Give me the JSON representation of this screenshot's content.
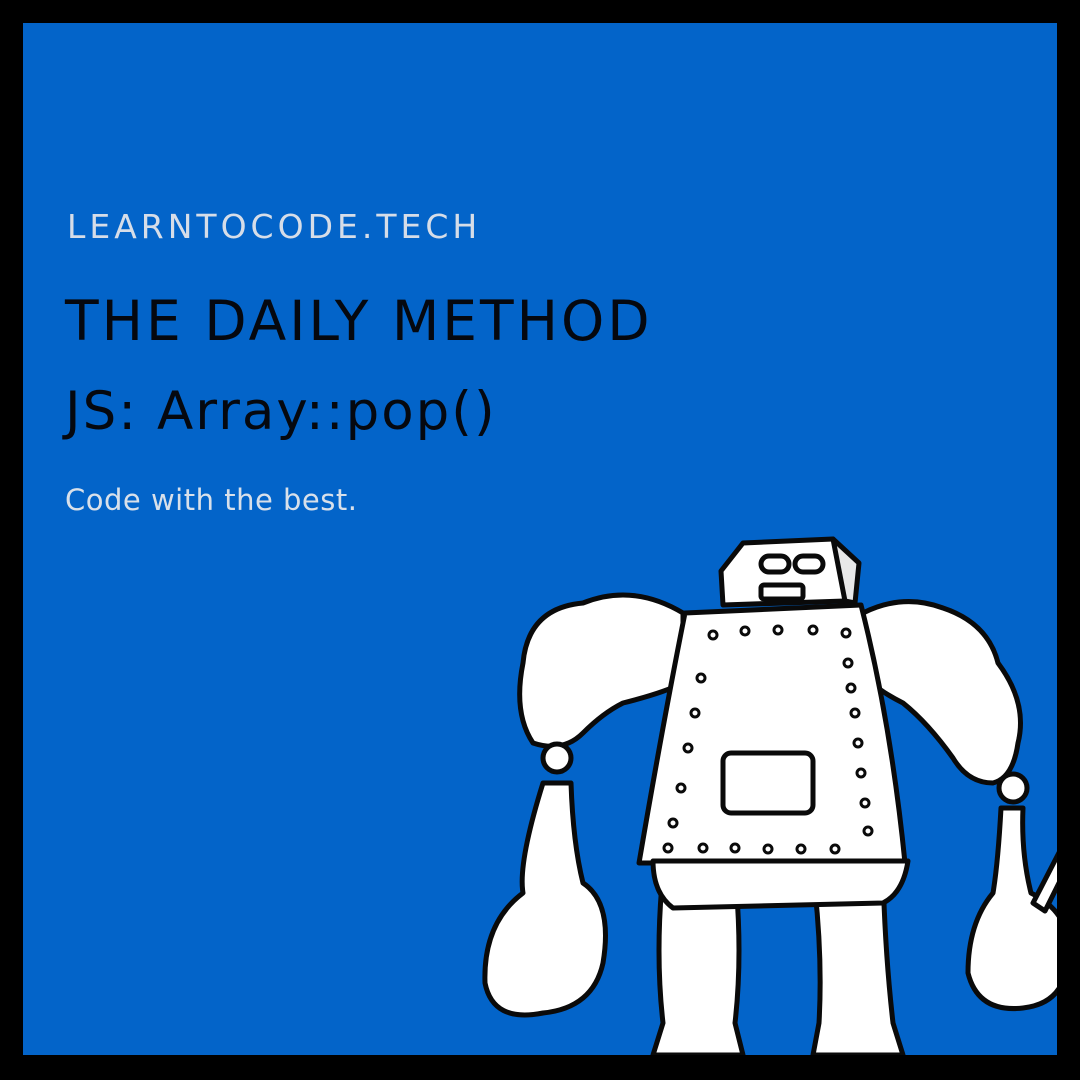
{
  "brand": {
    "site": "LEARNTOCODE.TECH"
  },
  "heading": {
    "title": "THE DAILY METHOD",
    "subtitle": "JS: Array::pop()"
  },
  "tagline": "Code with the best.",
  "illustration": {
    "subject": "robot-carrying-bags-icon"
  },
  "colors": {
    "background": "#0364c9",
    "border": "#000000",
    "heading": "#05080f",
    "light_text": "#d8e0ea"
  }
}
